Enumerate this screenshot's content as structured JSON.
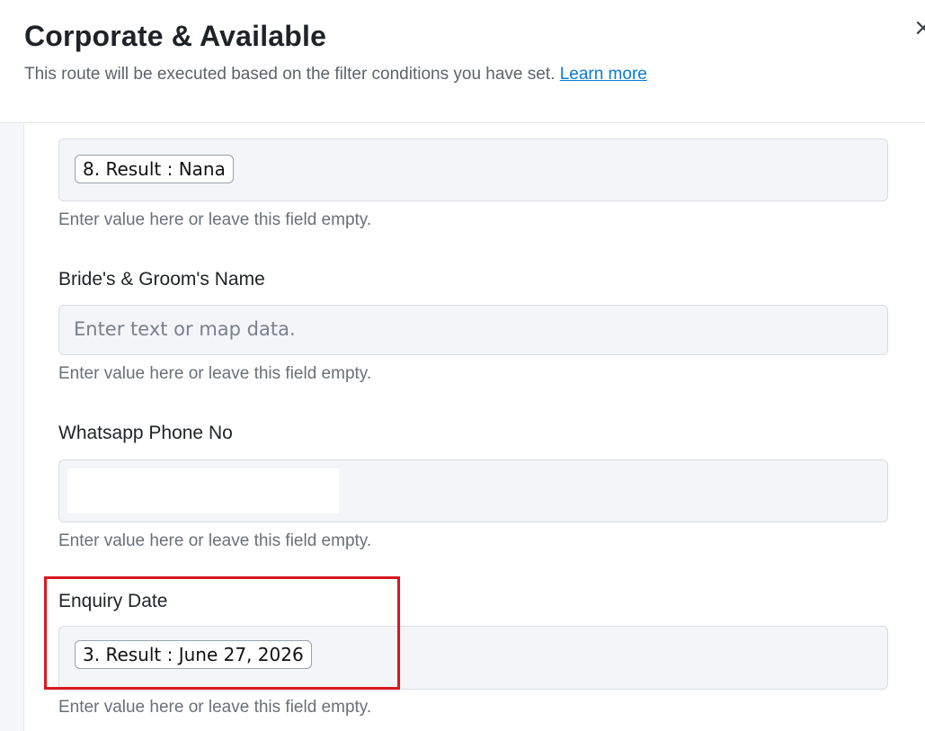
{
  "dialog": {
    "title": "Corporate & Available",
    "subtitle": "This route will be executed based on the filter conditions you have set.",
    "learn_more": "Learn more",
    "close_glyph": "×"
  },
  "fields": [
    {
      "label": "",
      "value": "8. Result : Nana",
      "hint": "Enter value here or leave this field empty."
    },
    {
      "label": "Bride's & Groom's Name",
      "placeholder": "Enter text or map data.",
      "hint": "Enter value here or leave this field empty."
    },
    {
      "label": "Whatsapp Phone No",
      "hint": "Enter value here or leave this field empty."
    },
    {
      "label": "Enquiry Date",
      "value": "3. Result : June 27, 2026",
      "hint": "Enter value here or leave this field empty."
    }
  ],
  "colors": {
    "accent_link": "#0a7bd6",
    "highlight_border": "#d71920"
  }
}
